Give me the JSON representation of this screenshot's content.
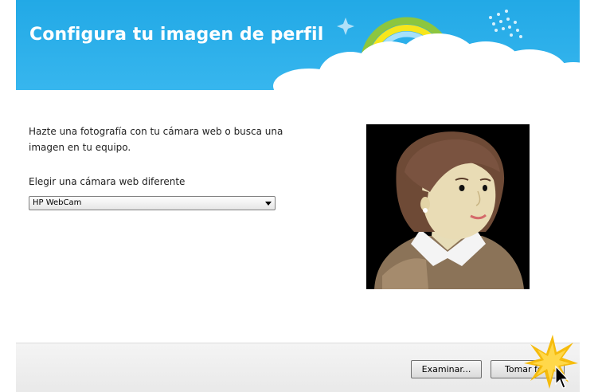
{
  "header": {
    "title": "Configura tu imagen de perfil"
  },
  "content": {
    "intro_text": "Hazte una fotografía con tu cámara web o busca una imagen en tu equipo.",
    "camera_label": "Elegir una cámara web diferente",
    "camera_select": {
      "selected": "HP WebCam"
    }
  },
  "footer": {
    "browse_label": "Examinar...",
    "take_photo_label": "Tomar foto"
  },
  "colors": {
    "header_blue": "#2aaeea",
    "cloud_white": "#ffffff",
    "rainbow_green": "#8cc63f",
    "rainbow_yellow": "#f7e61b",
    "avatar_background": "#000000"
  },
  "icons": [
    "sparkle-icon",
    "rainbow-icon",
    "cloud-icon",
    "dropdown-arrow-icon",
    "cursor-icon",
    "click-burst-icon"
  ]
}
